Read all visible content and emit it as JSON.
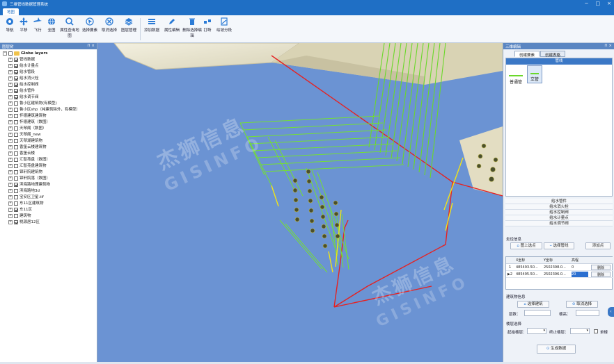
{
  "app": {
    "title": "三维管线数据管理系统",
    "window_controls": [
      "−",
      "□",
      "×"
    ]
  },
  "tabs": [
    {
      "label": "地图"
    }
  ],
  "toolbar": {
    "items": [
      {
        "label": "导航",
        "icon": "navigation-icon"
      },
      {
        "label": "平移",
        "icon": "pan-icon"
      },
      {
        "label": "飞行",
        "icon": "fly-icon"
      },
      {
        "label": "全图",
        "icon": "globe-icon"
      },
      {
        "label": "属性查询地图",
        "icon": "query-icon"
      },
      {
        "label": "选择要素",
        "icon": "select-feature-icon"
      },
      {
        "label": "取消选择",
        "icon": "cancel-select-icon"
      },
      {
        "label": "图层管理",
        "icon": "layers-icon"
      },
      {
        "label": "添加数据",
        "icon": "add-data-icon"
      },
      {
        "label": "属性编辑",
        "icon": "edit-attribute-icon"
      },
      {
        "label": "删除选择编辑",
        "icon": "delete-icon"
      },
      {
        "label": "打断",
        "icon": "break-icon"
      },
      {
        "label": "绘坡分段",
        "icon": "slope-icon"
      }
    ]
  },
  "layer_panel": {
    "title": "图层树",
    "root": "Globe layers",
    "items": [
      {
        "label": "管线数据",
        "checked": true
      },
      {
        "label": "给水计量点",
        "checked": true
      },
      {
        "label": "给水管段",
        "checked": true
      },
      {
        "label": "给水消火栓",
        "checked": true
      },
      {
        "label": "给水控制阀",
        "checked": true
      },
      {
        "label": "给水管件",
        "checked": true
      },
      {
        "label": "给水调节阀",
        "checked": true
      },
      {
        "label": "鲁小区建筑物(有模型)",
        "checked": false
      },
      {
        "label": "鲁小区shp（纯建筑除外，有模型）",
        "checked": false
      },
      {
        "label": "怀德建筑建筑物",
        "checked": false
      },
      {
        "label": "怀德建筑（数图）",
        "checked": false
      },
      {
        "label": "天琴阁（数图）",
        "checked": false
      },
      {
        "label": "天琴阁_new",
        "checked": false
      },
      {
        "label": "天琴湖建筑物",
        "checked": false
      },
      {
        "label": "香堡云楼建筑物",
        "checked": false
      },
      {
        "label": "香堡云楼",
        "checked": false
      },
      {
        "label": "汇智苑盘（数图）",
        "checked": false
      },
      {
        "label": "汇智苑盘建筑物",
        "checked": false
      },
      {
        "label": "锦轩院建筑物",
        "checked": false
      },
      {
        "label": "锦轩院落（数图）",
        "checked": false
      },
      {
        "label": "滨海路地理建筑物",
        "checked": true
      },
      {
        "label": "滨海路地3d",
        "checked": false
      },
      {
        "label": "宝安区卫星.tif",
        "checked": false
      },
      {
        "label": "东11区建筑物",
        "checked": false
      },
      {
        "label": "东11区",
        "checked": true
      },
      {
        "label": "建筑物",
        "checked": false
      },
      {
        "label": "桃源居12区",
        "checked": true
      }
    ]
  },
  "watermark": {
    "cn": "杰狮信息",
    "en": "GISINFO"
  },
  "right_panel": {
    "title": "三维编辑",
    "tabs": [
      "创建要素",
      "创建表格"
    ],
    "pipe_header": "管线",
    "pipe_types": [
      {
        "label": "普通管"
      },
      {
        "label": "立管"
      }
    ],
    "layers": [
      "给水管件",
      "给水消火栓",
      "给水控制阀",
      "给水计量点",
      "给水调节阀"
    ],
    "trunk_info": {
      "title": "走径信息",
      "map_pick": "图上选点",
      "select_line": "选择管线",
      "insert_btn": "添加点"
    },
    "table": {
      "headers": [
        "",
        "X坐标",
        "Y坐标",
        "高程",
        ""
      ],
      "rows": [
        {
          "idx": "1",
          "x": "485493.50...",
          "y": "2502398.0...",
          "z": "0",
          "action": "删除"
        },
        {
          "idx": "▶2",
          "x": "485495.50...",
          "y": "2502396.0...",
          "z": "20",
          "action": "删除"
        }
      ]
    },
    "building_info": {
      "title": "建筑物信息",
      "select": "选择建筑",
      "cancel": "取消选择",
      "floor_label": "层数：",
      "height_label": "楼高："
    },
    "floor_select": {
      "title": "楼层选择",
      "start_label": "起始楼层：",
      "end_label": "终止楼层：",
      "single_label": "单楼"
    },
    "generate": "生成数据"
  }
}
